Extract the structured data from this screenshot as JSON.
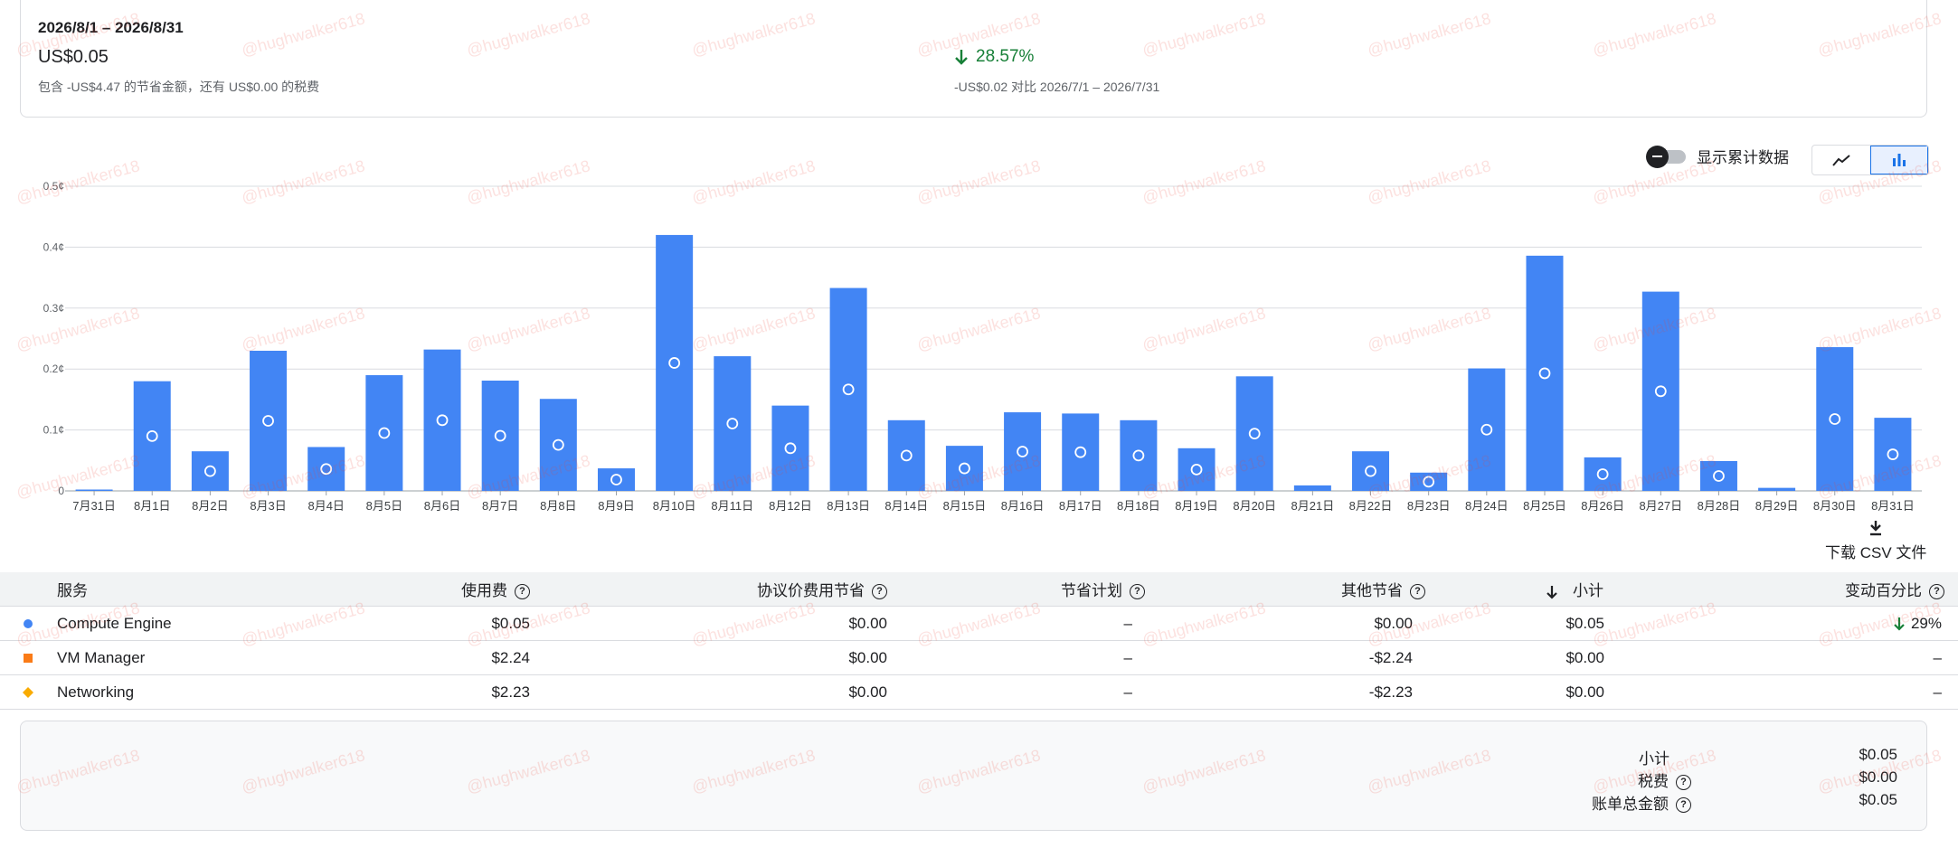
{
  "summary": {
    "period": "2026/8/1 – 2026/8/31",
    "total": "US$0.05",
    "note": "包含 -US$4.47 的节省金额，还有 US$0.00 的税费",
    "change_pct": "28.57%",
    "compare": "-US$0.02 对比 2026/7/1 – 2026/7/31",
    "change_color": "#188038"
  },
  "controls": {
    "cumulative_label": "显示累计数据",
    "line_view_icon": "line-chart-icon",
    "bar_view_icon": "bar-chart-icon",
    "download_label": "下载 CSV 文件"
  },
  "chart_data": {
    "type": "bar",
    "categories": [
      "7月31日",
      "8月1日",
      "8月2日",
      "8月3日",
      "8月4日",
      "8月5日",
      "8月6日",
      "8月7日",
      "8月8日",
      "8月9日",
      "8月10日",
      "8月11日",
      "8月12日",
      "8月13日",
      "8月14日",
      "8月15日",
      "8月16日",
      "8月17日",
      "8月18日",
      "8月19日",
      "8月20日",
      "8月21日",
      "8月22日",
      "8月23日",
      "8月24日",
      "8月25日",
      "8月26日",
      "8月27日",
      "8月28日",
      "8月29日",
      "8月30日",
      "8月31日"
    ],
    "values": [
      0.0,
      0.18,
      0.065,
      0.23,
      0.072,
      0.19,
      0.232,
      0.181,
      0.151,
      0.037,
      0.42,
      0.221,
      0.14,
      0.333,
      0.116,
      0.074,
      0.129,
      0.127,
      0.116,
      0.07,
      0.188,
      0.009,
      0.065,
      0.03,
      0.201,
      0.386,
      0.055,
      0.327,
      0.049,
      0.005,
      0.236,
      0.12
    ],
    "yticks": [
      "0",
      "0.1¢",
      "0.2¢",
      "0.3¢",
      "0.4¢",
      "0.5¢"
    ],
    "ylim": [
      0,
      0.5
    ],
    "grid": true,
    "bar_color": "#4285f4"
  },
  "table": {
    "headers": {
      "service": "服务",
      "usage": "使用费",
      "negotiated": "协议价费用节省",
      "savings_plan": "节省计划",
      "other": "其他节省",
      "subtotal": "小计",
      "pct": "变动百分比"
    },
    "rows": [
      {
        "service": "Compute Engine",
        "usage": "$0.05",
        "negotiated": "$0.00",
        "savings_plan": "–",
        "other": "$0.00",
        "subtotal": "$0.05",
        "pct": "29%",
        "color": "#4285f4",
        "marker": "circle"
      },
      {
        "service": "VM Manager",
        "usage": "$2.24",
        "negotiated": "$0.00",
        "savings_plan": "–",
        "other": "-$2.24",
        "subtotal": "$0.00",
        "pct": "–",
        "color": "#fa7b17",
        "marker": "square"
      },
      {
        "service": "Networking",
        "usage": "$2.23",
        "negotiated": "$0.00",
        "savings_plan": "–",
        "other": "-$2.23",
        "subtotal": "$0.00",
        "pct": "–",
        "color": "#f9ab00",
        "marker": "diamond"
      }
    ]
  },
  "totals": {
    "subtotal_label": "小计",
    "subtotal": "$0.05",
    "tax_label": "税费",
    "tax": "$0.00",
    "bill_label": "账单总金额",
    "bill": "$0.05"
  },
  "watermark": "@hughwalker618"
}
